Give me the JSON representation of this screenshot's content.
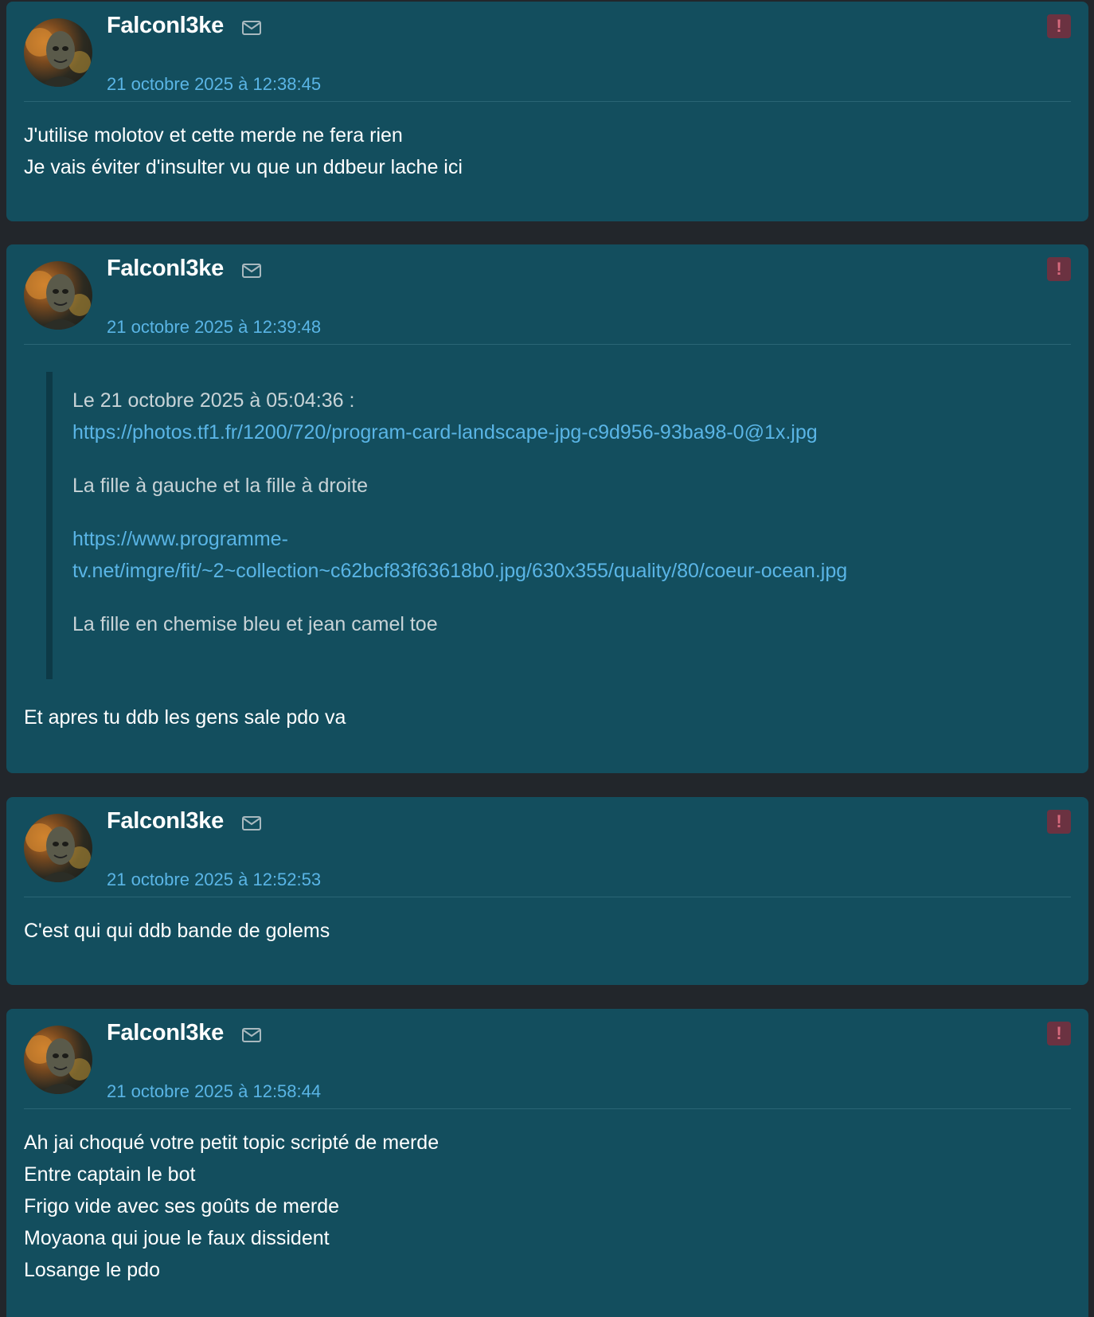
{
  "posts": [
    {
      "username": "Falconl3ke",
      "date": "21 octobre 2025 à 12:38:45",
      "lines": [
        "J'utilise molotov et cette merde ne fera rien",
        "Je vais éviter d'insulter vu que un ddbeur lache ici"
      ]
    },
    {
      "username": "Falconl3ke",
      "date": "21 octobre 2025 à 12:39:48",
      "quote": {
        "header": "Le 21 octobre 2025 à 05:04:36 :",
        "link1": "https://photos.tf1.fr/1200/720/program-card-landscape-jpg-c9d956-93ba98-0@1x.jpg",
        "text1": "La fille à gauche et la fille à droite",
        "link2_line1": "https://www.programme-",
        "link2_line2": "tv.net/imgre/fit/~2~collection~c62bcf83f63618b0.jpg/630x355/quality/80/coeur-ocean.jpg",
        "text2": "La fille en chemise bleu et jean camel toe"
      },
      "lines": [
        "Et apres tu ddb les gens sale pdo va"
      ]
    },
    {
      "username": "Falconl3ke",
      "date": "21 octobre 2025 à 12:52:53",
      "lines": [
        "C'est qui qui ddb bande de golems"
      ]
    },
    {
      "username": "Falconl3ke",
      "date": "21 octobre 2025 à 12:58:44",
      "lines": [
        "Ah jai choqué votre petit topic scripté de merde",
        "Entre captain le bot",
        "Frigo vide avec ses goûts de merde",
        "Moyaona qui joue le faux dissident",
        "Losange le pdo"
      ]
    }
  ],
  "icons": {
    "mail": "envelope-icon",
    "report": "alert-icon",
    "report_glyph": "!"
  },
  "colors": {
    "page_bg": "#22262b",
    "card_bg": "#134e5e",
    "date": "#5ab5e6",
    "link": "#5ab5e6",
    "report_bg": "#6b3241"
  }
}
